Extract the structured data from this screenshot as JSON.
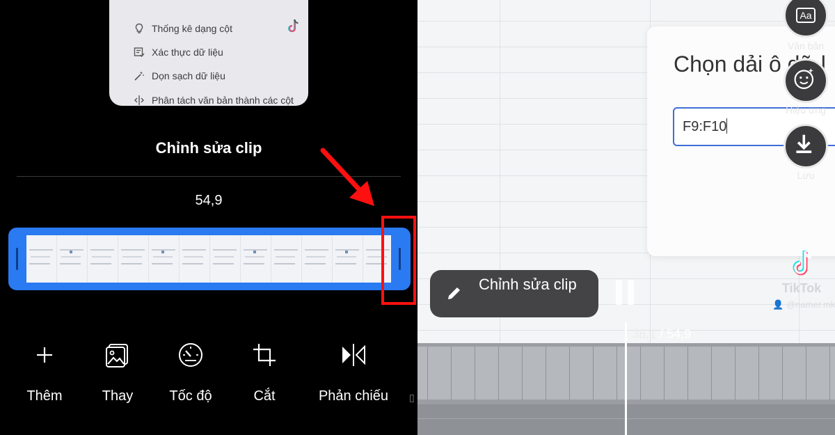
{
  "left": {
    "menu_items": [
      {
        "label": "Thống kê dạng cột",
        "icon": "lightbulb-icon"
      },
      {
        "label": "Xác thực dữ liệu",
        "icon": "data-validation-icon"
      },
      {
        "label": "Dọn sạch dữ liệu",
        "icon": "magic-wand-icon"
      },
      {
        "label": "Phân tách văn bản thành các cột",
        "icon": "split-columns-icon"
      }
    ],
    "title": "Chỉnh sửa clip",
    "duration": "54,9",
    "tools": [
      {
        "label": "Thêm",
        "icon": "plus-icon"
      },
      {
        "label": "Thay",
        "icon": "replace-image-icon"
      },
      {
        "label": "Tốc độ",
        "icon": "speedometer-icon"
      },
      {
        "label": "Cắt",
        "icon": "crop-icon"
      },
      {
        "label": "Phản chiếu",
        "icon": "mirror-icon"
      }
    ]
  },
  "right": {
    "dialog": {
      "title": "Chọn dải ô dữ l",
      "range_value": "F9:F10"
    },
    "side_buttons": [
      {
        "label": "Văn bản",
        "icon": "text-aa-icon"
      },
      {
        "label": "Hiệu ứng",
        "icon": "face-effect-icon"
      },
      {
        "label": "Lưu",
        "icon": "download-icon"
      }
    ],
    "watermark": {
      "name": "TikTok",
      "user": "@namer.mkt"
    },
    "edit_chip": {
      "label": "Chỉnh sửa clip"
    },
    "time": {
      "current": "38,1",
      "separator": "/",
      "total": "54,9"
    }
  },
  "colors": {
    "trim_blue": "#2a7af2",
    "highlight_red": "#ff1010",
    "chip_bg": "#444446"
  }
}
